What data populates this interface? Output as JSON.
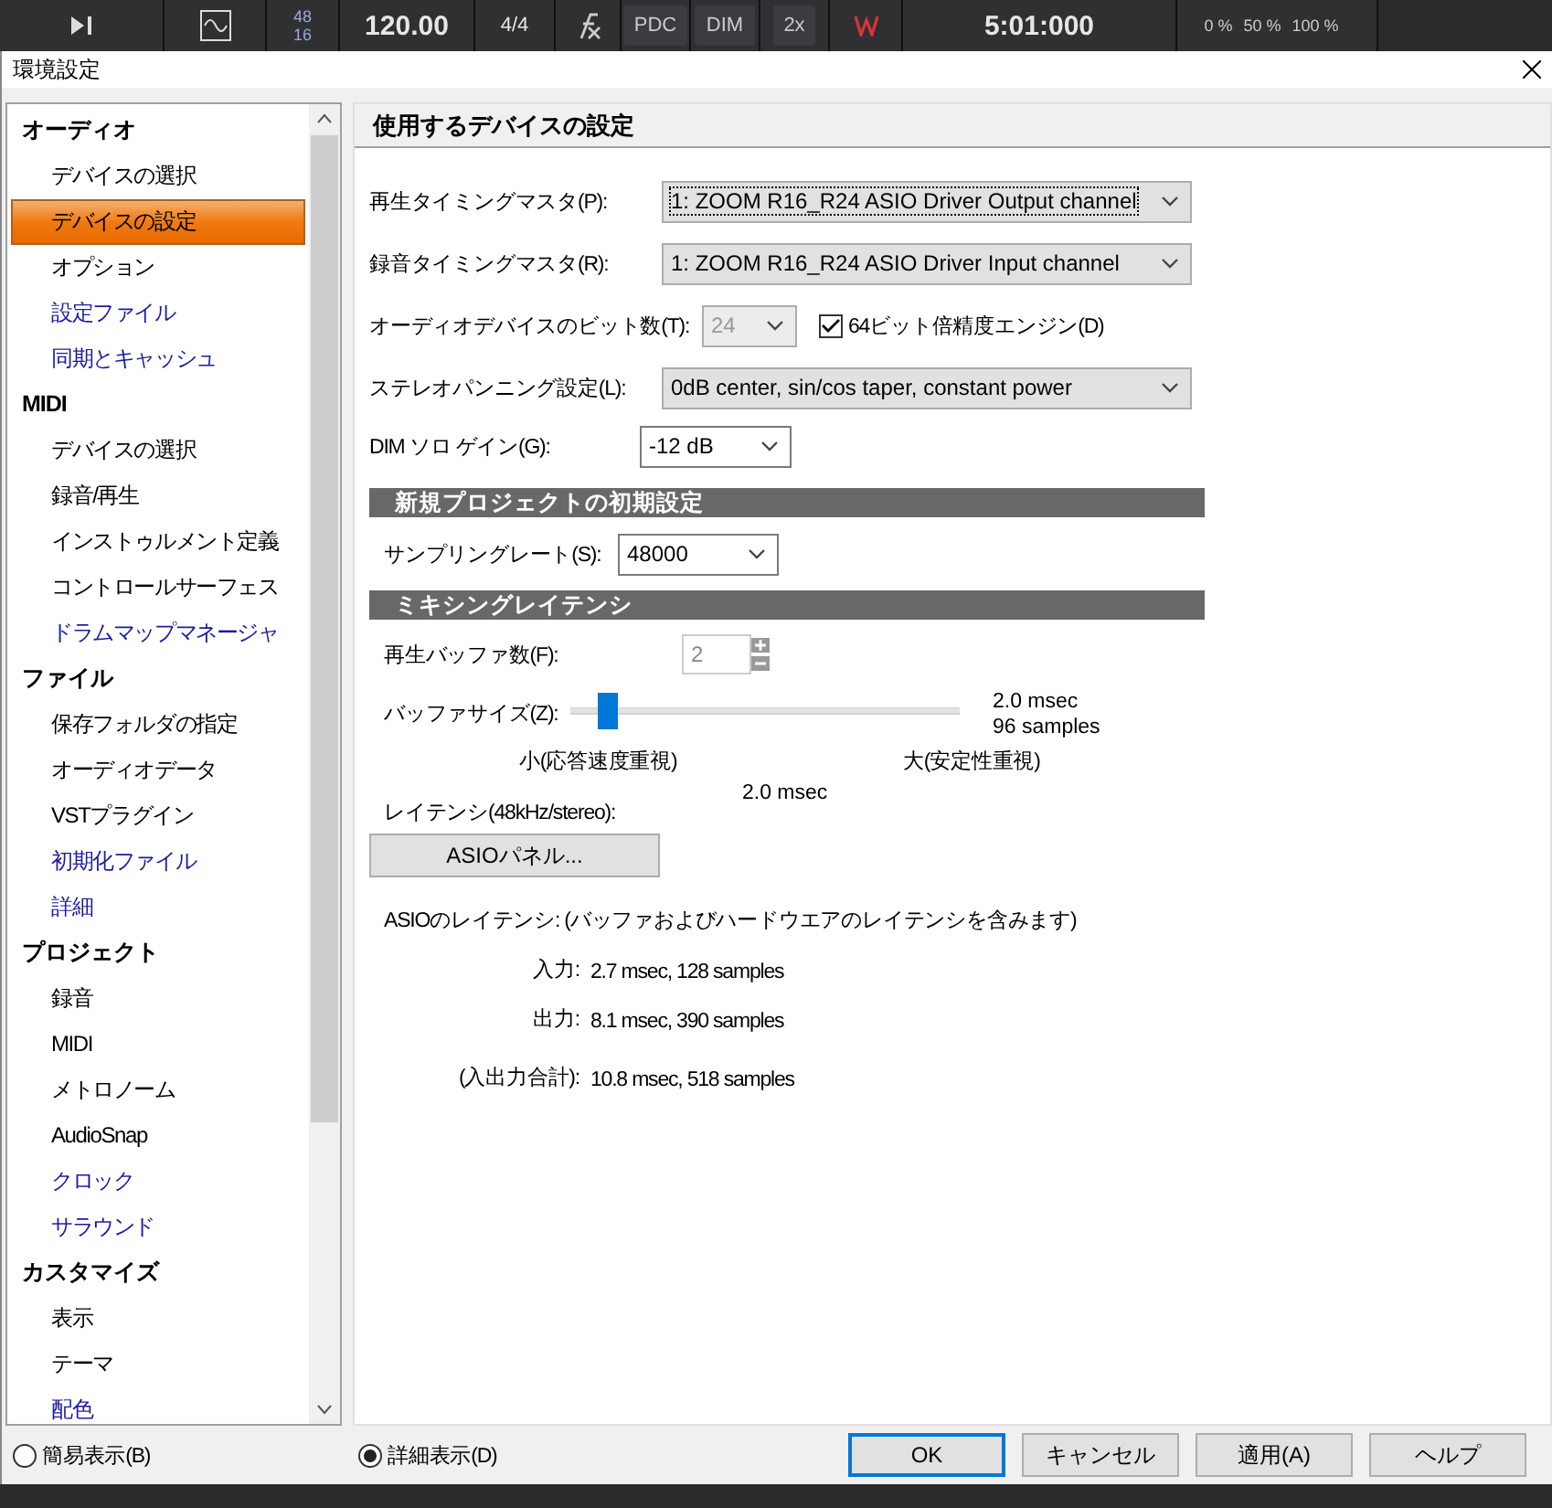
{
  "toolbar": {
    "segments": [
      {
        "kind": "stack",
        "lines": [
          "48",
          "16"
        ]
      },
      {
        "kind": "value",
        "text": "120.00"
      },
      {
        "kind": "value",
        "text": "4/4"
      },
      {
        "kind": "button",
        "text": "PDC"
      },
      {
        "kind": "button",
        "text": "DIM"
      },
      {
        "kind": "button",
        "text": "2x"
      },
      {
        "kind": "time",
        "text": "5:01:000"
      },
      {
        "kind": "scale",
        "lines": [
          "0 %",
          "50 %",
          "100 %"
        ]
      }
    ]
  },
  "window": {
    "title": "環境設定"
  },
  "sidebar": {
    "groups": [
      {
        "label": "オーディオ",
        "children": [
          {
            "label": "デバイスの選択",
            "selected": false,
            "color": "#000000"
          },
          {
            "label": "デバイスの設定",
            "selected": true,
            "color": "#000000"
          },
          {
            "label": "オプション",
            "selected": false,
            "color": "#000000"
          },
          {
            "label": "設定ファイル",
            "selected": false,
            "color": "#1c1c9c"
          },
          {
            "label": "同期とキャッシュ",
            "selected": false,
            "color": "#1c1c9c"
          }
        ]
      },
      {
        "label": "MIDI",
        "children": [
          {
            "label": "デバイスの選択",
            "selected": false,
            "color": "#000000"
          },
          {
            "label": "録音/再生",
            "selected": false,
            "color": "#000000"
          },
          {
            "label": "インストゥルメント定義",
            "selected": false,
            "color": "#000000"
          },
          {
            "label": "コントロールサーフェス",
            "selected": false,
            "color": "#000000"
          },
          {
            "label": "ドラムマップマネージャ",
            "selected": false,
            "color": "#1c1c9c"
          }
        ]
      },
      {
        "label": "ファイル",
        "children": [
          {
            "label": "保存フォルダの指定",
            "selected": false,
            "color": "#000000"
          },
          {
            "label": "オーディオデータ",
            "selected": false,
            "color": "#000000"
          },
          {
            "label": "VSTプラグイン",
            "selected": false,
            "color": "#000000"
          },
          {
            "label": "初期化ファイル",
            "selected": false,
            "color": "#1c1c9c"
          },
          {
            "label": "詳細",
            "selected": false,
            "color": "#1c1c9c"
          }
        ]
      },
      {
        "label": "プロジェクト",
        "children": [
          {
            "label": "録音",
            "selected": false,
            "color": "#000000"
          },
          {
            "label": "MIDI",
            "selected": false,
            "color": "#000000"
          },
          {
            "label": "メトロノーム",
            "selected": false,
            "color": "#000000"
          },
          {
            "label": "AudioSnap",
            "selected": false,
            "color": "#000000"
          },
          {
            "label": "クロック",
            "selected": false,
            "color": "#1c1c9c"
          },
          {
            "label": "サラウンド",
            "selected": false,
            "color": "#1c1c9c"
          }
        ]
      },
      {
        "label": "カスタマイズ",
        "children": [
          {
            "label": "表示",
            "selected": false,
            "color": "#000000"
          },
          {
            "label": "テーマ",
            "selected": false,
            "color": "#000000"
          },
          {
            "label": "配色",
            "selected": false,
            "color": "#1c1c9c"
          }
        ]
      }
    ]
  },
  "panel": {
    "title": "使用するデバイスの設定",
    "playback_master": {
      "label": "再生タイミングマスタ(P):",
      "value": "1: ZOOM R16_R24 ASIO Driver Output channel"
    },
    "record_master": {
      "label": "録音タイミングマスタ(R):",
      "value": "1: ZOOM R16_R24 ASIO Driver Input channel"
    },
    "bit_depth": {
      "label": "オーディオデバイスのビット数(T):",
      "value": "24",
      "disabled": true
    },
    "double_precision": {
      "label": "64ビット倍精度エンジン(D)",
      "checked": true
    },
    "panning": {
      "label": "ステレオパンニング設定(L):",
      "value": "0dB center, sin/cos taper, constant power"
    },
    "dim_gain": {
      "label": "DIM ソロ ゲイン(G):",
      "value": "-12 dB"
    },
    "new_project": {
      "title": "新規プロジェクトの初期設定",
      "sample_rate": {
        "label": "サンプリングレート(S):",
        "value": "48000"
      }
    },
    "mixing_latency": {
      "title": "ミキシングレイテンシ",
      "buffers": {
        "label": "再生バッファ数(F):",
        "value": "2",
        "disabled": true
      },
      "buffer_size": {
        "label": "バッファサイズ(Z):",
        "level": 0.07,
        "reading_time": "2.0 msec",
        "reading_samples": "96 samples",
        "min_label": "小(応答速度重視)",
        "max_label": "大(安定性重視)"
      },
      "latency": {
        "label": "レイテンシ(48kHz/stereo):",
        "value": "2.0 msec"
      },
      "asio_button": "ASIOパネル...",
      "asio_note": "ASIOのレイテンシ: (バッファおよびハードウエアのレイテンシを含みます)",
      "asio_rows": [
        {
          "label": "入力:",
          "value": "2.7 msec, 128 samples"
        },
        {
          "label": "出力:",
          "value": "8.1 msec, 390 samples"
        },
        {
          "label": "(入出力合計):",
          "value": "10.8 msec, 518 samples"
        }
      ]
    }
  },
  "view_modes": [
    {
      "label": "簡易表示(B)",
      "selected": false
    },
    {
      "label": "詳細表示(D)",
      "selected": true
    }
  ],
  "buttons": [
    {
      "label": "OK",
      "default": true
    },
    {
      "label": "キャンセル",
      "default": false
    },
    {
      "label": "適用(A)",
      "default": false
    },
    {
      "label": "ヘルプ",
      "default": false
    }
  ]
}
